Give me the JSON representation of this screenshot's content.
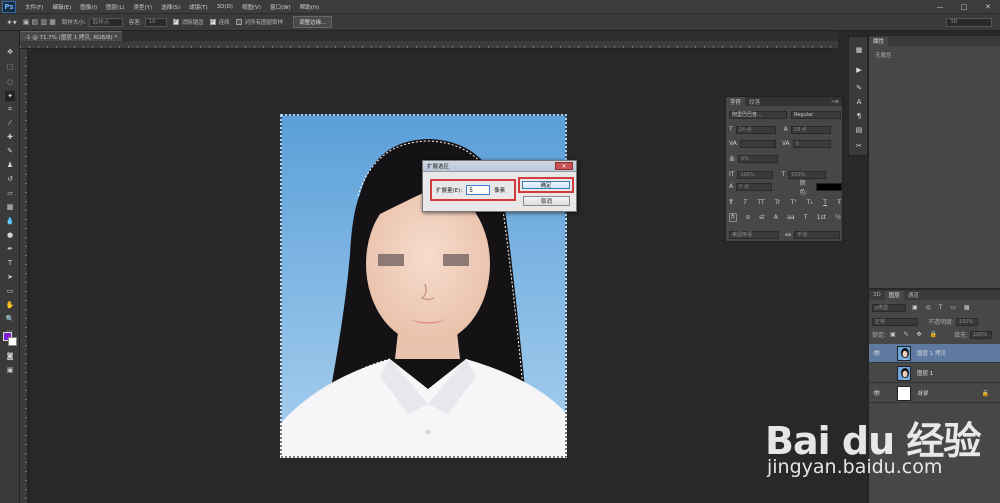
{
  "app": {
    "logo": "Ps",
    "window_controls": [
      "—",
      "□",
      "✕"
    ]
  },
  "menubar": {
    "items": [
      "文件(F)",
      "编辑(E)",
      "图像(I)",
      "图层(L)",
      "类型(Y)",
      "选择(S)",
      "滤镜(T)",
      "3D(D)",
      "视图(V)",
      "窗口(W)",
      "帮助(H)"
    ]
  },
  "options": {
    "sample_size_label": "取样大小:",
    "sample_size_value": "取样点",
    "tolerance_label": "容差:",
    "tolerance_value": "10",
    "antialias": "消除锯齿",
    "contiguous": "连续",
    "sample_all": "对所有图层取样",
    "refine_edge": "调整边缘...",
    "workspace": "3D"
  },
  "document": {
    "tab_title": "-1 @ 71.7% (图层 1 拷贝, RGB/8) *"
  },
  "dialog": {
    "title": "扩展选区",
    "close": "✕",
    "expand_label": "扩展量(E):",
    "expand_value": "5",
    "unit": "像素",
    "ok_label": "确定",
    "cancel_label": "取消"
  },
  "character_panel": {
    "tabs": [
      "字符",
      "段落"
    ],
    "font_family": "阿里巴巴普...",
    "font_style": "Regular",
    "font_size": "14 点",
    "leading": "18 点",
    "tracking": "0",
    "kerning_scale": "0%",
    "vertical_scale": "100%",
    "horizontal_scale": "100%",
    "baseline": "0 点",
    "color_label": "颜色:",
    "styles": [
      "T",
      "T",
      "TT",
      "Tr",
      "T¹",
      "T₁",
      "T",
      "Ŧ"
    ],
    "opentype": [
      "fi",
      "σ",
      "st",
      "A",
      "aa",
      "T",
      "1st",
      "½"
    ],
    "language": "美国英语",
    "antialias": "平滑"
  },
  "properties_panel": {
    "tab": "属性",
    "content": "无属性"
  },
  "layers_panel": {
    "tabs": [
      "3D",
      "图层",
      "通道"
    ],
    "filter_kind": "ρ类型",
    "blend_mode": "正常",
    "opacity_label": "不透明度:",
    "opacity_value": "100%",
    "lock_label": "锁定:",
    "fill_label": "填充:",
    "fill_value": "100%",
    "layers": [
      {
        "name": "图层 1 拷贝",
        "visible": true,
        "selected": true
      },
      {
        "name": "图层 1",
        "visible": false,
        "selected": false
      },
      {
        "name": "背景",
        "visible": true,
        "selected": false
      }
    ]
  },
  "watermark": {
    "logo": "Bai du 经验",
    "url": "jingyan.baidu.com"
  },
  "colors": {
    "foreground": "#7a1fd6",
    "background": "#ffffff",
    "selected_layer": "#5f7aa0"
  }
}
